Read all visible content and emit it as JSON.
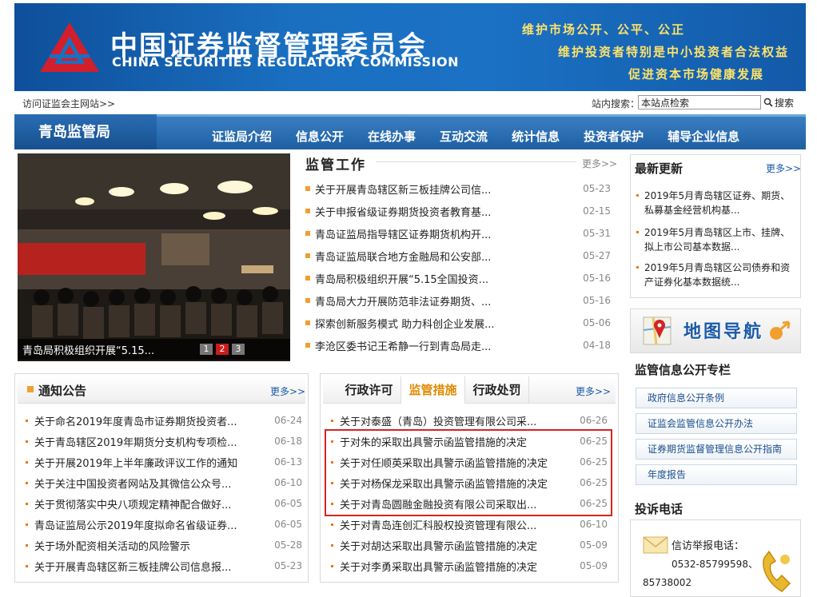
{
  "banner": {
    "title": "中国证券监督管理委员会",
    "subtitle": "CHINA SECURITIES REGULATORY COMMISSION",
    "slogan1": "维护市场公开、公平、公正",
    "slogan2": "维护投资者特别是中小投资者合法权益",
    "slogan3": "促进资本市场健康发展",
    "accent": "#1a6fc0",
    "slogan_color": "#ffe36a"
  },
  "topbar": {
    "portal_link": "访问证监会主网站>>",
    "search_label": "站内搜索：",
    "search_value": "本站点检索",
    "search_button": "搜索"
  },
  "nav": {
    "brand": "青岛监管局",
    "items": [
      "证监局介绍",
      "信息公开",
      "在线办事",
      "互动交流",
      "统计信息",
      "投资者保护",
      "辅导企业信息"
    ]
  },
  "photo": {
    "caption": "青岛局积极组织开展“5.15...",
    "pages": [
      "1",
      "2",
      "3"
    ],
    "active_page": "2"
  },
  "work": {
    "title": "监管工作",
    "more": "更多>>",
    "items": [
      {
        "text": "关于开展青岛辖区新三板挂牌公司信...",
        "date": "05-23"
      },
      {
        "text": "关于申报省级证券期货投资者教育基...",
        "date": "02-15"
      },
      {
        "text": "青岛证监局指导辖区证券期货机构开...",
        "date": "05-31"
      },
      {
        "text": "青岛证监局联合地方金融局和公安部...",
        "date": "05-27"
      },
      {
        "text": "青岛局积极组织开展“5.15全国投资...",
        "date": "05-16"
      },
      {
        "text": "青岛局大力开展防范非法证券期货、...",
        "date": "05-16"
      },
      {
        "text": "探索创新服务模式 助力科创企业发展...",
        "date": "05-06"
      },
      {
        "text": "李沧区委书记王希静一行到青岛局走...",
        "date": "04-18"
      }
    ]
  },
  "notice": {
    "title": "通知公告",
    "more": "更多>>",
    "items": [
      {
        "text": "关于命名2019年度青岛市证券期货投资者...",
        "date": "06-24"
      },
      {
        "text": "关于青岛辖区2019年期货分支机构专项检...",
        "date": "06-18"
      },
      {
        "text": "关于开展2019年上半年廉政评议工作的通知",
        "date": "06-13"
      },
      {
        "text": "关于关注中国投资者网站及其微信公众号...",
        "date": "06-10"
      },
      {
        "text": "关于贯彻落实中央八项规定精神配合做好...",
        "date": "06-05"
      },
      {
        "text": "青岛证监局公示2019年度拟命名省级证券...",
        "date": "06-05"
      },
      {
        "text": "关于场外配资相关活动的风险警示",
        "date": "05-28"
      },
      {
        "text": "关于开展青岛辖区新三板挂牌公司信息报...",
        "date": "05-23"
      }
    ]
  },
  "tabs": {
    "labels": [
      "行政许可",
      "监管措施",
      "行政处罚"
    ],
    "active": "监管措施",
    "more": "更多>>",
    "items": [
      {
        "text": "关于对泰盛（青岛）投资管理有限公司采...",
        "date": "06-26"
      },
      {
        "text": "于对朱的采取出具警示函监管措施的决定",
        "date": "06-25"
      },
      {
        "text": "关于对任顺英采取出具警示函监管措施的决定",
        "date": "06-25"
      },
      {
        "text": "关于对杨保龙采取出具警示函监管措施的决定",
        "date": "06-25"
      },
      {
        "text": "关于对青岛圆融金融投资有限公司采取出...",
        "date": "06-25"
      },
      {
        "text": "关于对青岛连创汇科股权投资管理有限公...",
        "date": "06-10"
      },
      {
        "text": "关于对胡达采取出具警示函监管措施的决定",
        "date": "05-09"
      },
      {
        "text": "关于对李勇采取出具警示函监管措施的决定",
        "date": "05-09"
      }
    ],
    "highlight_color": "#d42424"
  },
  "latest": {
    "title": "最新更新",
    "more": "更多>>",
    "items": [
      "2019年5月青岛辖区证券、期货、私募基金经营机构基...",
      "2019年5月青岛辖区上市、挂牌、拟上市公司基本数据...",
      "2019年5月青岛辖区公司债券和资产证券化基本数据统..."
    ]
  },
  "map": {
    "label": "地图导航",
    "icon": "map-pin-icon"
  },
  "disclosure": {
    "title": "监管信息公开专栏",
    "links": [
      "政府信息公开条例",
      "证监会监管信息公开办法",
      "证券期货监督管理信息公开指南",
      "年度报告"
    ]
  },
  "complaint": {
    "title": "投诉电话",
    "label": "信访举报电话：",
    "phone1": "0532-85799598、",
    "phone2": "85738002",
    "icon": "telephone-icon"
  }
}
